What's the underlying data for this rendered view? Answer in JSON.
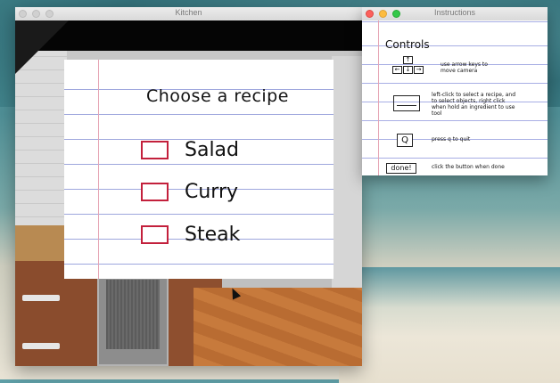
{
  "kitchen_window": {
    "title": "Kitchen",
    "recipe_card": {
      "heading": "Choose a recipe",
      "options": [
        {
          "label": "Salad"
        },
        {
          "label": "Curry"
        },
        {
          "label": "Steak"
        }
      ]
    }
  },
  "instructions_window": {
    "title": "Instructions",
    "heading": "Controls",
    "items": [
      {
        "icon": "arrow-keys-icon",
        "text": "use arrow keys to move camera"
      },
      {
        "icon": "mouse-icon",
        "text": "left-click to select a recipe, and to select objects, right click when hold an ingredient to use tool"
      },
      {
        "icon": "q-key-icon",
        "key": "Q",
        "text": "press q to quit"
      },
      {
        "icon": "done-button",
        "key": "done!",
        "text": "click the button when done"
      }
    ]
  },
  "colors": {
    "checkbox_border": "#c3203c",
    "paper_line": "#9ea6dd",
    "margin_line": "#e6a4b4"
  }
}
